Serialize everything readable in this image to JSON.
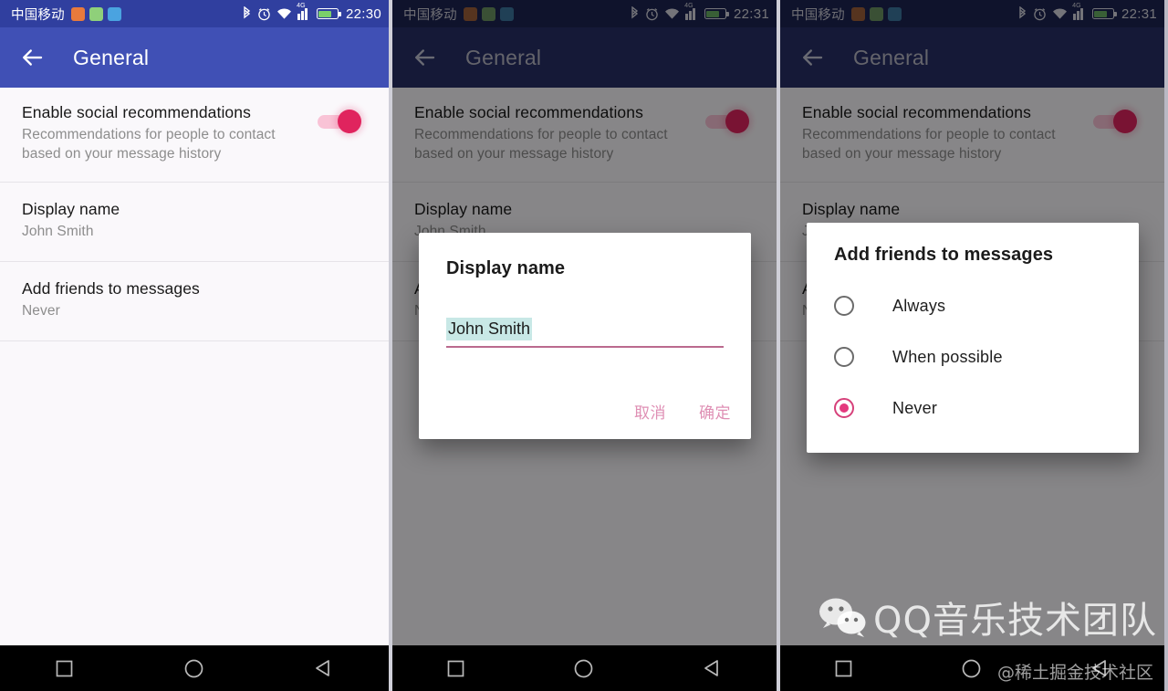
{
  "theme": {
    "statusbar_bg": "#303f9f",
    "appbar_bg": "#4050b5",
    "statusbar_bg_dim": "#1c2352",
    "appbar_bg_dim": "#272f66",
    "accent_pink": "#e0245e",
    "track_pink": "#f9c3d6",
    "dialog_button": "#df8fb4",
    "selection_highlight": "#c8e8e6",
    "list_bg": "#faf8fb",
    "scrim": "rgba(0,0,0,0.46)"
  },
  "panels": [
    {
      "id": "panel-1",
      "statusbar": {
        "carrier": "中国移动",
        "time": "22:30",
        "app_icons": [
          "orange-app-icon",
          "green-app-icon",
          "blue-app-icon"
        ],
        "icons": [
          "bluetooth-icon",
          "alarm-icon",
          "wifi-icon",
          "signal-4g-icon",
          "battery-icon"
        ],
        "network_tag": "4G"
      },
      "appbar": {
        "back_icon": "back-arrow-icon",
        "title": "General"
      },
      "dialog": null
    },
    {
      "id": "panel-2",
      "statusbar": {
        "carrier": "中国移动",
        "time": "22:31",
        "app_icons": [
          "orange-app-icon",
          "green-app-icon",
          "blue-app-icon"
        ],
        "icons": [
          "bluetooth-icon",
          "alarm-icon",
          "wifi-icon",
          "signal-4g-icon",
          "battery-icon"
        ],
        "network_tag": "4G"
      },
      "appbar": {
        "back_icon": "back-arrow-icon",
        "title": "General"
      },
      "dialog": "text-input"
    },
    {
      "id": "panel-3",
      "statusbar": {
        "carrier": "中国移动",
        "time": "22:31",
        "app_icons": [
          "orange-app-icon",
          "green-app-icon",
          "blue-app-icon"
        ],
        "icons": [
          "bluetooth-icon",
          "alarm-icon",
          "wifi-icon",
          "signal-4g-icon",
          "battery-icon"
        ],
        "network_tag": "4G"
      },
      "appbar": {
        "back_icon": "back-arrow-icon",
        "title": "General"
      },
      "dialog": "radio-list"
    }
  ],
  "settings_list": [
    {
      "key": "enable-social-recommendations",
      "title": "Enable social recommendations",
      "subtitle": "Recommendations for people to contact based on your message history",
      "control": "switch",
      "switch_on": true
    },
    {
      "key": "display-name",
      "title": "Display name",
      "subtitle": "John Smith",
      "control": "none"
    },
    {
      "key": "add-friends-to-messages",
      "title": "Add friends to messages",
      "subtitle": "Never",
      "control": "none"
    }
  ],
  "name_dialog": {
    "title": "Display name",
    "field_value": "John Smith",
    "field_placeholder": "Display name",
    "cancel_label": "取消",
    "confirm_label": "确定"
  },
  "radio_dialog": {
    "title": "Add friends to messages",
    "options": [
      {
        "label": "Always",
        "selected": false
      },
      {
        "label": "When possible",
        "selected": false
      },
      {
        "label": "Never",
        "selected": true
      }
    ]
  },
  "navbar": {
    "recents_icon": "square-recents-icon",
    "home_icon": "circle-home-icon",
    "back_icon": "triangle-back-icon"
  },
  "watermark": {
    "logo_icon": "wechat-logo-icon",
    "brand": "QQ音乐技术团队",
    "credit": "@稀土掘金技术社区"
  }
}
